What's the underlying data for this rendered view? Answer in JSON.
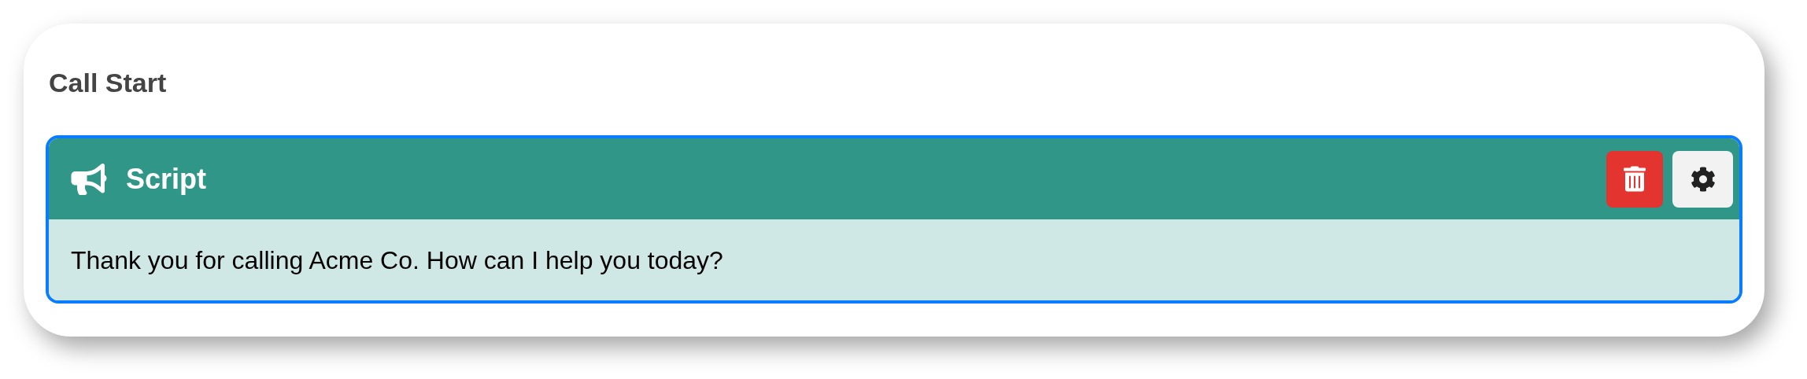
{
  "section": {
    "title": "Call Start"
  },
  "blocks": [
    {
      "kind": "script",
      "title": "Script",
      "text": "Thank you for calling Acme Co. How can I help you today?",
      "selected": true
    }
  ]
}
